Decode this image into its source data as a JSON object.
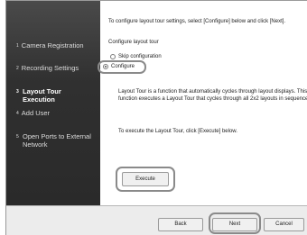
{
  "sidebar": {
    "items": [
      {
        "num": "1",
        "label": "Camera Registration"
      },
      {
        "num": "2",
        "label": "Recording Settings"
      },
      {
        "num": "3",
        "label": "Layout Tour\nExecution"
      },
      {
        "num": "4",
        "label": "Add User"
      },
      {
        "num": "5",
        "label": "Open Ports to External\nNetwork"
      }
    ]
  },
  "main": {
    "instruction": "To configure layout tour settings, select [Configure] below and click [Next].",
    "section_title": "Configure layout tour",
    "option_skip": "Skip configuration",
    "option_configure": "Configure",
    "description_line1": "Layout Tour is a function that automatically cycles through layout displays. This",
    "description_line2": "function executes a Layout Tour that cycles through all 2x2 layouts in sequence.",
    "execute_instruction": "To execute the Layout Tour, click [Execute] below.",
    "execute_label": "Execute"
  },
  "footer": {
    "back_label": "Back",
    "next_label": "Next",
    "cancel_label": "Cancel"
  }
}
